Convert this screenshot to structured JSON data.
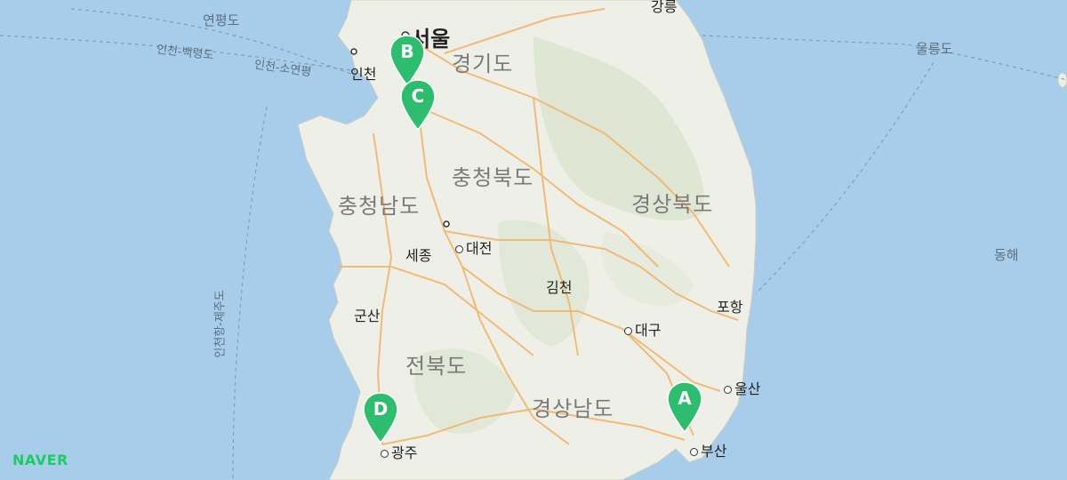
{
  "provider": "NAVER",
  "regions": [
    "경기도",
    "충청북도",
    "충청남도",
    "경상북도",
    "전북도",
    "경상남도"
  ],
  "cities": [
    "서울",
    "인천",
    "세종",
    "대전",
    "김천",
    "군산",
    "대구",
    "포항",
    "울산",
    "부산",
    "광주",
    "강릉"
  ],
  "islands": [
    "연평도",
    "울릉도"
  ],
  "seas": [
    "동해"
  ],
  "routes": [
    "인천-백령도",
    "인천-소연평",
    "인천항-제주도"
  ],
  "markers": [
    {
      "label": "A",
      "near": "부산",
      "color": "#2dbd6e"
    },
    {
      "label": "B",
      "near": "서울",
      "color": "#2dbd6e"
    },
    {
      "label": "C",
      "near": "서울",
      "color": "#2dbd6e"
    },
    {
      "label": "D",
      "near": "광주",
      "color": "#2dbd6e"
    }
  ]
}
